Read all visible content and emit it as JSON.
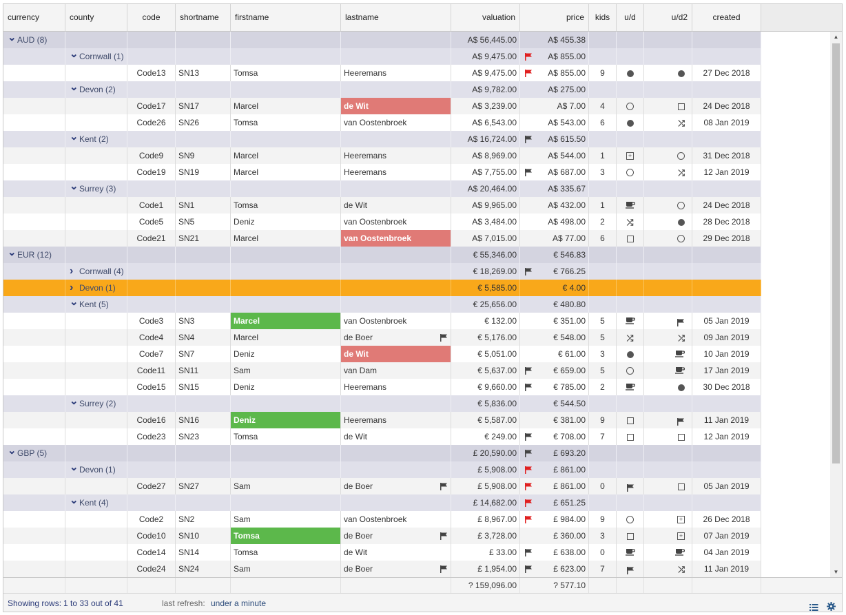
{
  "columns": [
    {
      "key": "currency",
      "label": "currency",
      "w": 90,
      "align": "left"
    },
    {
      "key": "county",
      "label": "county",
      "w": 90,
      "align": "left"
    },
    {
      "key": "code",
      "label": "code",
      "w": 70,
      "align": "center"
    },
    {
      "key": "shortname",
      "label": "shortname",
      "w": 80,
      "align": "left"
    },
    {
      "key": "firstname",
      "label": "firstname",
      "w": 160,
      "align": "left"
    },
    {
      "key": "lastname",
      "label": "lastname",
      "w": 160,
      "align": "left"
    },
    {
      "key": "valuation",
      "label": "valuation",
      "w": 100,
      "align": "right"
    },
    {
      "key": "price",
      "label": "price",
      "w": 100,
      "align": "right"
    },
    {
      "key": "kids",
      "label": "kids",
      "w": 40,
      "align": "center"
    },
    {
      "key": "ud",
      "label": "u/d",
      "w": 40,
      "align": "center"
    },
    {
      "key": "ud2",
      "label": "u/d2",
      "w": 70,
      "align": "right"
    },
    {
      "key": "created",
      "label": "created",
      "w": 100,
      "align": "center"
    }
  ],
  "rows": [
    {
      "t": "g1",
      "currency": "AUD (8)",
      "open": true,
      "valuation": "A$ 56,445.00",
      "price": "A$ 455.38"
    },
    {
      "t": "g2",
      "county": "Cornwall (1)",
      "open": true,
      "valuation": "A$ 9,475.00",
      "vflag": "red",
      "price": "A$ 855.00"
    },
    {
      "t": "d",
      "code": "Code13",
      "shortname": "SN13",
      "firstname": "Tomsa",
      "lastname": "Heeremans",
      "valuation": "A$ 9,475.00",
      "vflag": "red",
      "price": "A$ 855.00",
      "kids": "9",
      "ud": "dot",
      "ud2": "dot",
      "created": "27 Dec 2018"
    },
    {
      "t": "g2",
      "county": "Devon (2)",
      "open": true,
      "valuation": "A$ 9,782.00",
      "price": "A$ 275.00"
    },
    {
      "t": "d",
      "code": "Code17",
      "shortname": "SN17",
      "firstname": "Marcel",
      "lastname": "de Wit",
      "lastHL": "red",
      "valuation": "A$ 3,239.00",
      "price": "A$ 7.00",
      "kids": "4",
      "ud": "circ",
      "ud2": "sq",
      "created": "24 Dec 2018"
    },
    {
      "t": "d",
      "code": "Code26",
      "shortname": "SN26",
      "firstname": "Tomsa",
      "lastname": "van Oostenbroek",
      "valuation": "A$ 6,543.00",
      "price": "A$ 543.00",
      "kids": "6",
      "ud": "dot",
      "ud2": "shuffle",
      "created": "08 Jan 2019"
    },
    {
      "t": "g2",
      "county": "Kent (2)",
      "open": true,
      "valuation": "A$ 16,724.00",
      "vflag": "dark",
      "price": "A$ 615.50"
    },
    {
      "t": "d",
      "code": "Code9",
      "shortname": "SN9",
      "firstname": "Marcel",
      "lastname": "Heeremans",
      "valuation": "A$ 8,969.00",
      "price": "A$ 544.00",
      "kids": "1",
      "ud": "sqp",
      "ud2": "circ",
      "created": "31 Dec 2018"
    },
    {
      "t": "d",
      "code": "Code19",
      "shortname": "SN19",
      "firstname": "Marcel",
      "lastname": "Heeremans",
      "valuation": "A$ 7,755.00",
      "vflag": "dark",
      "price": "A$ 687.00",
      "kids": "3",
      "ud": "circ",
      "ud2": "shuffle",
      "created": "12 Jan 2019"
    },
    {
      "t": "g2",
      "county": "Surrey (3)",
      "open": true,
      "valuation": "A$ 20,464.00",
      "price": "A$ 335.67"
    },
    {
      "t": "d",
      "code": "Code1",
      "shortname": "SN1",
      "firstname": "Tomsa",
      "lastname": "de Wit",
      "valuation": "A$ 9,965.00",
      "price": "A$ 432.00",
      "kids": "1",
      "ud": "cup",
      "ud2": "circ",
      "created": "24 Dec 2018"
    },
    {
      "t": "d",
      "code": "Code5",
      "shortname": "SN5",
      "firstname": "Deniz",
      "lastname": "van Oostenbroek",
      "valuation": "A$ 3,484.00",
      "price": "A$ 498.00",
      "kids": "2",
      "ud": "shuffle",
      "ud2": "dot",
      "created": "28 Dec 2018"
    },
    {
      "t": "d",
      "code": "Code21",
      "shortname": "SN21",
      "firstname": "Marcel",
      "lastname": "van Oostenbroek",
      "lastHL": "red",
      "valuation": "A$ 7,015.00",
      "price": "A$ 77.00",
      "kids": "6",
      "ud": "sq",
      "ud2": "circ",
      "created": "29 Dec 2018"
    },
    {
      "t": "g1",
      "currency": "EUR (12)",
      "open": true,
      "valuation": "€ 55,346.00",
      "price": "€ 546.83"
    },
    {
      "t": "g2",
      "county": "Cornwall (4)",
      "open": false,
      "valuation": "€ 18,269.00",
      "vflag": "dark",
      "price": "€ 766.25"
    },
    {
      "t": "sel",
      "county": "Devon (1)",
      "open": false,
      "valuation": "€ 5,585.00",
      "price": "€ 4.00"
    },
    {
      "t": "g2",
      "county": "Kent (5)",
      "open": true,
      "valuation": "€ 25,656.00",
      "price": "€ 480.80"
    },
    {
      "t": "d",
      "code": "Code3",
      "shortname": "SN3",
      "firstname": "Marcel",
      "firstHL": "green",
      "lastname": "van Oostenbroek",
      "valuation": "€ 132.00",
      "price": "€ 351.00",
      "kids": "5",
      "ud": "cup",
      "ud2": "flag",
      "created": "05 Jan 2019"
    },
    {
      "t": "d",
      "code": "Code4",
      "shortname": "SN4",
      "firstname": "Marcel",
      "lastname": "de Boer",
      "lflag": "dark",
      "valuation": "€ 5,176.00",
      "price": "€ 548.00",
      "kids": "5",
      "ud": "shuffle",
      "ud2": "shuffle",
      "created": "09 Jan 2019"
    },
    {
      "t": "d",
      "code": "Code7",
      "shortname": "SN7",
      "firstname": "Deniz",
      "lastname": "de Wit",
      "lastHL": "red",
      "valuation": "€ 5,051.00",
      "price": "€ 61.00",
      "kids": "3",
      "ud": "dot",
      "ud2": "cup",
      "created": "10 Jan 2019"
    },
    {
      "t": "d",
      "code": "Code11",
      "shortname": "SN11",
      "firstname": "Sam",
      "lastname": "van Dam",
      "valuation": "€ 5,637.00",
      "vflag": "dark",
      "price": "€ 659.00",
      "kids": "5",
      "ud": "circ",
      "ud2": "cup",
      "created": "17 Jan 2019"
    },
    {
      "t": "d",
      "code": "Code15",
      "shortname": "SN15",
      "firstname": "Deniz",
      "lastname": "Heeremans",
      "valuation": "€ 9,660.00",
      "vflag": "dark",
      "price": "€ 785.00",
      "kids": "2",
      "ud": "cup",
      "ud2": "dot",
      "created": "30 Dec 2018"
    },
    {
      "t": "g2",
      "county": "Surrey (2)",
      "open": true,
      "valuation": "€ 5,836.00",
      "price": "€ 544.50"
    },
    {
      "t": "d",
      "code": "Code16",
      "shortname": "SN16",
      "firstname": "Deniz",
      "firstHL": "green",
      "lastname": "Heeremans",
      "valuation": "€ 5,587.00",
      "price": "€ 381.00",
      "kids": "9",
      "ud": "sq",
      "ud2": "flag",
      "created": "11 Jan 2019"
    },
    {
      "t": "d",
      "code": "Code23",
      "shortname": "SN23",
      "firstname": "Tomsa",
      "lastname": "de Wit",
      "valuation": "€ 249.00",
      "vflag": "dark",
      "price": "€ 708.00",
      "kids": "7",
      "ud": "sq",
      "ud2": "sq",
      "created": "12 Jan 2019"
    },
    {
      "t": "g1",
      "currency": "GBP (5)",
      "open": true,
      "valuation": "£ 20,590.00",
      "vflag": "dark",
      "price": "£ 693.20"
    },
    {
      "t": "g2",
      "county": "Devon (1)",
      "open": true,
      "valuation": "£ 5,908.00",
      "vflag": "red",
      "price": "£ 861.00"
    },
    {
      "t": "d",
      "code": "Code27",
      "shortname": "SN27",
      "firstname": "Sam",
      "lastname": "de Boer",
      "lflag": "dark",
      "valuation": "£ 5,908.00",
      "vflag": "red",
      "price": "£ 861.00",
      "kids": "0",
      "ud": "flag",
      "ud2": "sq",
      "created": "05 Jan 2019"
    },
    {
      "t": "g2",
      "county": "Kent (4)",
      "open": true,
      "valuation": "£ 14,682.00",
      "vflag": "red",
      "price": "£ 651.25"
    },
    {
      "t": "d",
      "code": "Code2",
      "shortname": "SN2",
      "firstname": "Sam",
      "lastname": "van Oostenbroek",
      "valuation": "£ 8,967.00",
      "vflag": "red",
      "price": "£ 984.00",
      "kids": "9",
      "ud": "circ",
      "ud2": "sqp",
      "created": "26 Dec 2018"
    },
    {
      "t": "d",
      "code": "Code10",
      "shortname": "SN10",
      "firstname": "Tomsa",
      "firstHL": "green",
      "lastname": "de Boer",
      "lflag": "dark",
      "valuation": "£ 3,728.00",
      "price": "£ 360.00",
      "kids": "3",
      "ud": "sq",
      "ud2": "sqp",
      "created": "07 Jan 2019"
    },
    {
      "t": "d",
      "code": "Code14",
      "shortname": "SN14",
      "firstname": "Tomsa",
      "lastname": "de Wit",
      "valuation": "£ 33.00",
      "vflag": "dark",
      "price": "£ 638.00",
      "kids": "0",
      "ud": "cup",
      "ud2": "cup",
      "created": "04 Jan 2019"
    },
    {
      "t": "d",
      "code": "Code24",
      "shortname": "SN24",
      "firstname": "Sam",
      "lastname": "de Boer",
      "lflag": "dark",
      "valuation": "£ 1,954.00",
      "vflag": "dark",
      "price": "£ 623.00",
      "kids": "7",
      "ud": "flag",
      "ud2": "shuffle",
      "created": "11 Jan 2019"
    }
  ],
  "totals": {
    "valuation": "? 159,096.00",
    "price": "? 577.10"
  },
  "status": {
    "showing_label": "Showing rows:",
    "showing_value": "1 to 33 out of 41",
    "refresh_label": "last refresh:",
    "refresh_value": "under a minute",
    "icons": [
      "list-icon",
      "gear-icon"
    ]
  },
  "colors": {
    "group_header": "#d4d4e0",
    "subgroup": "#e0e0ea",
    "selected": "#f9a81a",
    "red_highlight": "#e07a76",
    "green_highlight": "#5cb84b",
    "flag_red": "#e02020",
    "flag_dark": "#444444"
  }
}
